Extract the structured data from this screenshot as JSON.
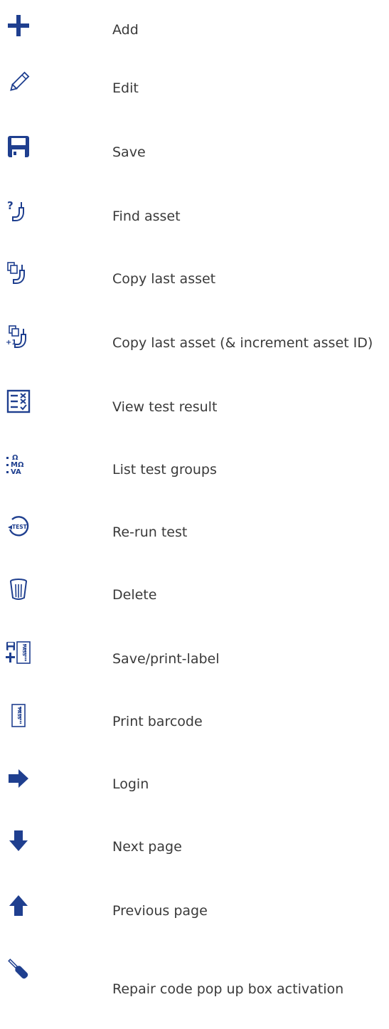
{
  "accent_color": "#1f3f8f",
  "text_color": "#3a3a3a",
  "items": [
    {
      "icon": "plus-icon",
      "label": "Add"
    },
    {
      "icon": "pencil-icon",
      "label": "Edit"
    },
    {
      "icon": "floppy-disk-icon",
      "label": "Save"
    },
    {
      "icon": "find-asset-icon",
      "label": "Find asset"
    },
    {
      "icon": "copy-asset-icon",
      "label": "Copy last asset"
    },
    {
      "icon": "copy-increment-asset-icon",
      "label": "Copy last asset (& increment asset ID)"
    },
    {
      "icon": "checklist-icon",
      "label": "View test result"
    },
    {
      "icon": "test-groups-icon",
      "label": "List test groups",
      "icon_text": [
        "Ω",
        "MΩ",
        "VA"
      ]
    },
    {
      "icon": "rerun-test-icon",
      "label": "Re-run test",
      "icon_text": "TEST"
    },
    {
      "icon": "trash-bin-icon",
      "label": "Delete"
    },
    {
      "icon": "save-print-label-icon",
      "label": "Save/print-label",
      "icon_text": "PASS"
    },
    {
      "icon": "barcode-icon",
      "label": "Print barcode",
      "icon_text": "PASS"
    },
    {
      "icon": "arrow-right-icon",
      "label": "Login"
    },
    {
      "icon": "arrow-down-icon",
      "label": "Next page"
    },
    {
      "icon": "arrow-up-icon",
      "label": "Previous page"
    },
    {
      "icon": "screwdriver-icon",
      "label": "Repair code pop up box activation"
    }
  ]
}
